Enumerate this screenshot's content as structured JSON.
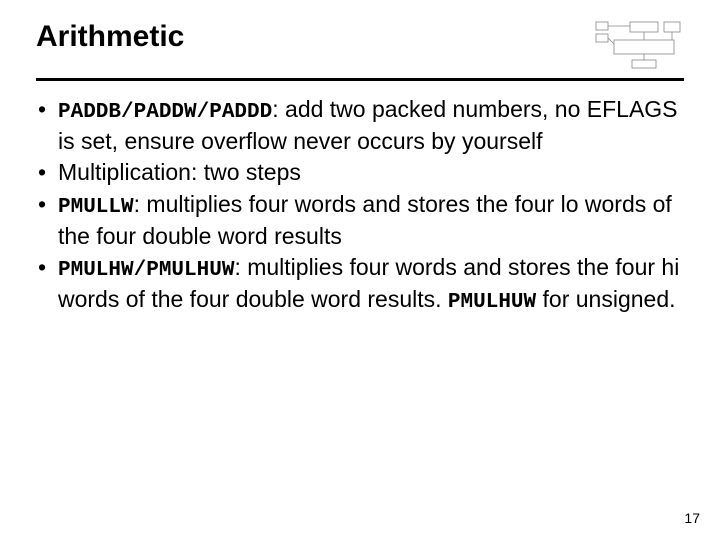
{
  "title": "Arithmetic",
  "bullets": [
    {
      "code": "PADDB/PADDW/PADDD",
      "rest": ": add two packed numbers, no EFLAGS is set, ensure overflow never occurs by yourself"
    },
    {
      "code": "",
      "rest": "Multiplication: two steps"
    },
    {
      "code": "PMULLW",
      "rest": ": multiplies four words and stores the four lo words of the four double word results"
    },
    {
      "code": "PMULHW/PMULHUW",
      "rest": ": multiplies four words and stores the four hi words of the four double word results. ",
      "code2": "PMULHUW",
      "rest2": " for unsigned."
    }
  ],
  "page_number": "17"
}
